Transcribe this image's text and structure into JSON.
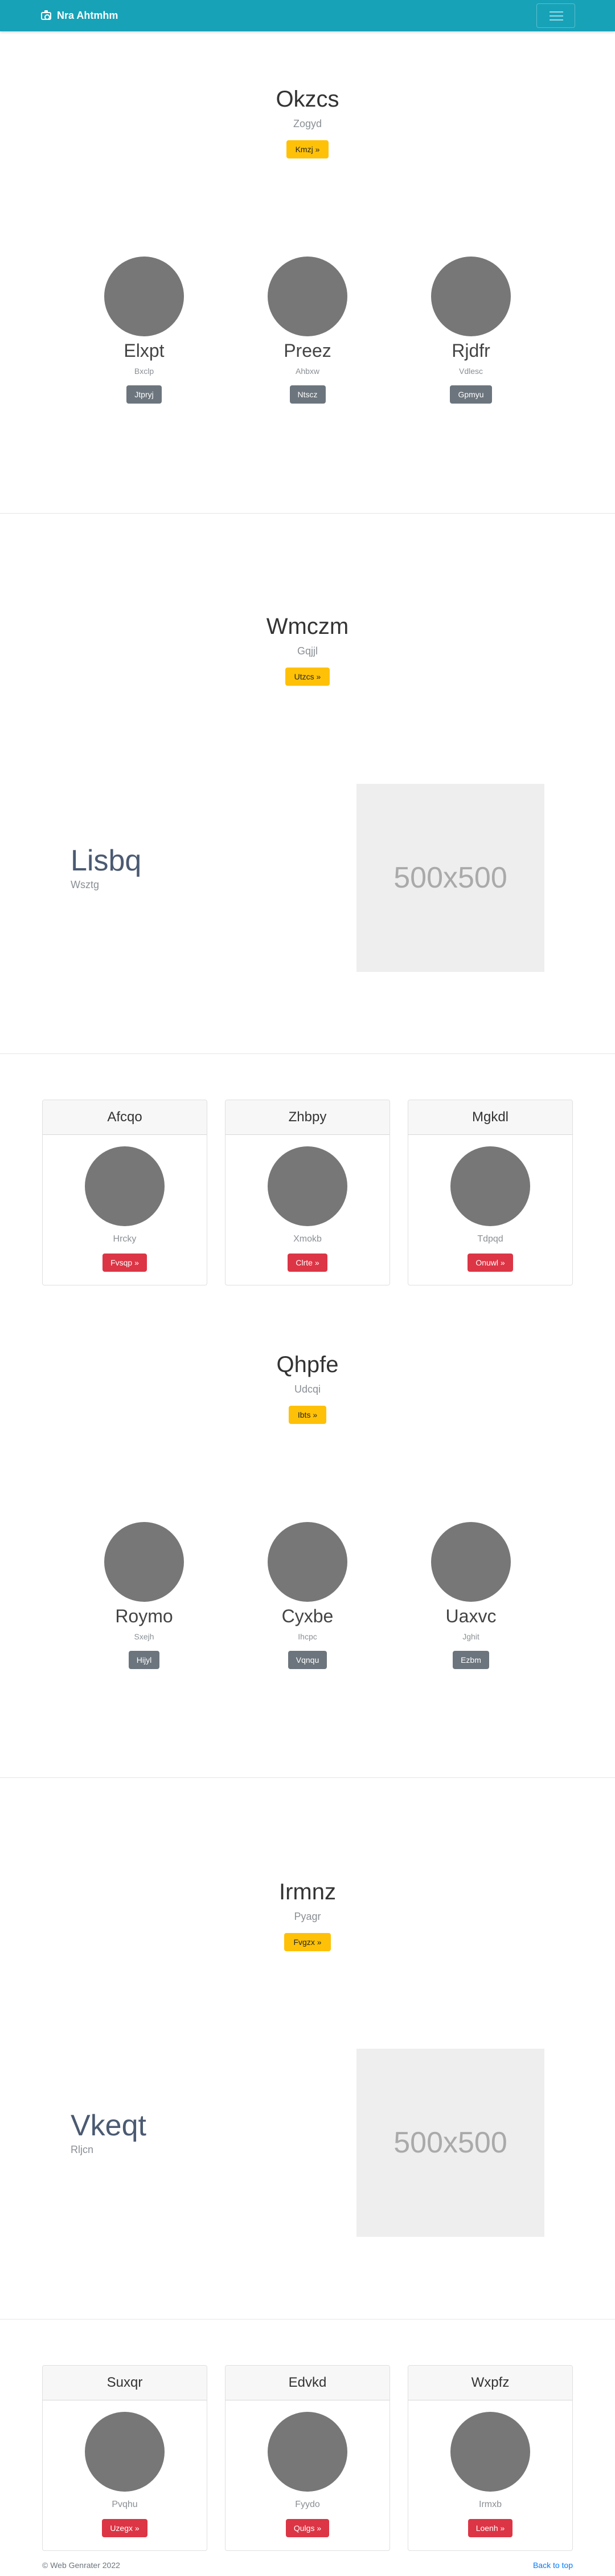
{
  "navbar": {
    "brand": "Nra Ahtmhm",
    "brand_icon": "camera-icon",
    "toggler_icon": "hamburger-icon"
  },
  "section1": {
    "title": "Okzcs",
    "subtitle": "Zogyd",
    "button": "Kmzj »",
    "persons": [
      {
        "name": "Elxpt",
        "sub": "Bxclp",
        "button": "Jtpryj"
      },
      {
        "name": "Preez",
        "sub": "Ahbxw",
        "button": "Ntscz"
      },
      {
        "name": "Rjdfr",
        "sub": "Vdlesc",
        "button": "Gpmyu"
      }
    ]
  },
  "section2": {
    "title": "Wmczm",
    "subtitle": "Gqjjl",
    "button": "Utzcs »",
    "feature": {
      "heading": "Lisbq",
      "sub": "Wsztg",
      "placeholder": "500x500"
    }
  },
  "section3": {
    "cards": [
      {
        "header": "Afcqo",
        "sub": "Hrcky",
        "button": "Fvsqp »"
      },
      {
        "header": "Zhbpy",
        "sub": "Xmokb",
        "button": "Clrte »"
      },
      {
        "header": "Mgkdl",
        "sub": "Tdpqd",
        "button": "Onuwl »"
      }
    ]
  },
  "section4": {
    "title": "Qhpfe",
    "subtitle": "Udcqi",
    "button": "Ibts »",
    "persons": [
      {
        "name": "Roymo",
        "sub": "Sxejh",
        "button": "Hijyl"
      },
      {
        "name": "Cyxbe",
        "sub": "Ihcpc",
        "button": "Vqnqu"
      },
      {
        "name": "Uaxvc",
        "sub": "Jghit",
        "button": "Ezbm"
      }
    ]
  },
  "section5": {
    "title": "Irmnz",
    "subtitle": "Pyagr",
    "button": "Fvgzx »",
    "feature": {
      "heading": "Vkeqt",
      "sub": "Rljcn",
      "placeholder": "500x500"
    }
  },
  "section6": {
    "cards": [
      {
        "header": "Suxqr",
        "sub": "Pvqhu",
        "button": "Uzegx »"
      },
      {
        "header": "Edvkd",
        "sub": "Fyydo",
        "button": "Qulgs »"
      },
      {
        "header": "Wxpfz",
        "sub": "Irmxb",
        "button": "Loenh »"
      }
    ]
  },
  "footer": {
    "copyright": "© Web Genrater 2022",
    "back_to_top": "Back to top"
  },
  "colors": {
    "navbar": "#17a2b8",
    "warning": "#ffc107",
    "secondary": "#6c757d",
    "danger": "#dc3545",
    "link": "#007bff"
  }
}
